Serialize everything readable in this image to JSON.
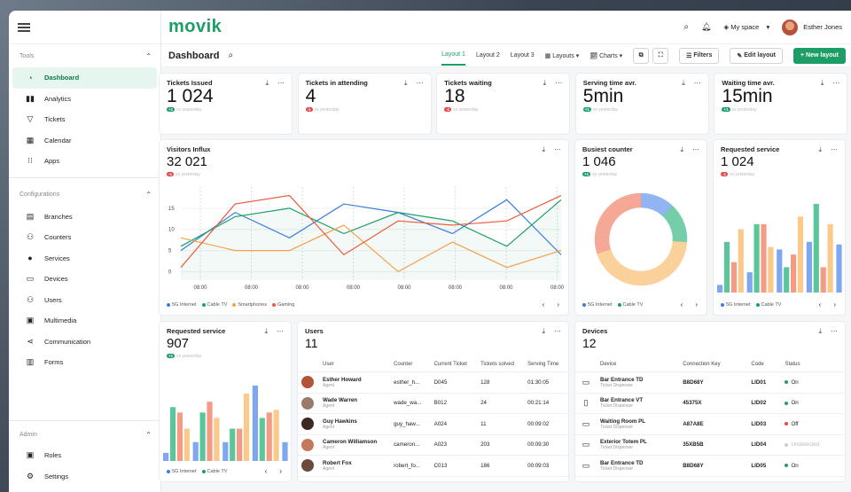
{
  "sidebar": {
    "sec1": "Tools",
    "sec2": "Configurations",
    "sec3": "Admin",
    "tools": [
      {
        "label": "Dashboard",
        "icon": "dashboard-icon"
      },
      {
        "label": "Analytics",
        "icon": "analytics-icon"
      },
      {
        "label": "Tickets",
        "icon": "ticket-icon"
      },
      {
        "label": "Calendar",
        "icon": "calendar-icon"
      },
      {
        "label": "Apps",
        "icon": "apps-icon"
      }
    ],
    "config": [
      {
        "label": "Branches"
      },
      {
        "label": "Counters"
      },
      {
        "label": "Services"
      },
      {
        "label": "Devices"
      },
      {
        "label": "Users"
      },
      {
        "label": "Multimedia"
      },
      {
        "label": "Communication"
      },
      {
        "label": "Forms"
      }
    ],
    "admin": [
      {
        "label": "Roles"
      },
      {
        "label": "Settings"
      }
    ]
  },
  "top": {
    "logo": "movik",
    "space": "My space",
    "user": "Esther Jones"
  },
  "sub": {
    "title": "Dashboard",
    "tabs": [
      "Layout 1",
      "Layout 2",
      "Layout 3"
    ],
    "layouts": "Layouts",
    "charts": "Charts",
    "filters": "Filters",
    "edit": "Edit layout",
    "new": "+ New layout"
  },
  "kpis": [
    {
      "title": "Tickets Issued",
      "value": "1 024",
      "delta": "+1",
      "vs": "vs yesterday",
      "dir": "up"
    },
    {
      "title": "Tickets in attending",
      "value": "4",
      "delta": "-1",
      "vs": "vs yesterday",
      "dir": "down"
    },
    {
      "title": "Tickets waiting",
      "value": "18",
      "delta": "-1",
      "vs": "vs yesterday",
      "dir": "down"
    },
    {
      "title": "Serving time avr.",
      "value": "5min",
      "delta": "+1",
      "vs": "vs yesterday",
      "dir": "up"
    },
    {
      "title": "Waiting time avr.",
      "value": "15min",
      "delta": "+1",
      "vs": "vs yesterday",
      "dir": "up"
    }
  ],
  "visitors": {
    "title": "Visitors Influx",
    "value": "32 021",
    "delta": "-1",
    "vs": "vs yesterday"
  },
  "busiest": {
    "title": "Busiest counter",
    "value": "1 046",
    "delta": "+1",
    "vs": "vs yesterday"
  },
  "req1": {
    "title": "Requested service",
    "value": "1 024",
    "delta": "-1",
    "vs": "vs yesterday"
  },
  "req2": {
    "title": "Requested service",
    "value": "907",
    "delta": "+1",
    "vs": "vs yesterday"
  },
  "users": {
    "title": "Users",
    "count": "11",
    "cols": [
      "User",
      "Counter",
      "Current Ticket",
      "Tickets solved",
      "Serving Time"
    ],
    "rows": [
      {
        "name": "Esther Howard",
        "role": "Agent",
        "counter": "esther_h...",
        "ticket": "D045",
        "solved": "128",
        "time": "01:30:05"
      },
      {
        "name": "Wade Warren",
        "role": "Agent",
        "counter": "wade_wa...",
        "ticket": "B012",
        "solved": "24",
        "time": "00:21:14"
      },
      {
        "name": "Guy Hawkins",
        "role": "Agent",
        "counter": "guy_haw...",
        "ticket": "A024",
        "solved": "11",
        "time": "00:09:02"
      },
      {
        "name": "Cameron Williamson",
        "role": "Agent",
        "counter": "cameron...",
        "ticket": "A023",
        "solved": "203",
        "time": "00:09:30"
      },
      {
        "name": "Robert Fox",
        "role": "Agent",
        "counter": "robert_fo...",
        "ticket": "C013",
        "solved": "186",
        "time": "00:09:03"
      }
    ]
  },
  "devices": {
    "title": "Devices",
    "count": "12",
    "cols": [
      "Device",
      "Connection Key",
      "Code",
      "Status"
    ],
    "rows": [
      {
        "name": "Bar Entrance TD",
        "type": "Ticket Dispenser",
        "key": "B8D68Y",
        "code": "LID01",
        "status": "On",
        "color": "#1e9e67"
      },
      {
        "name": "Bar Entrance VT",
        "type": "Ticket Dispenser",
        "key": "45375X",
        "code": "LID02",
        "status": "On",
        "color": "#1e9e67"
      },
      {
        "name": "Waiting Room PL",
        "type": "Ticket Dispenser",
        "key": "A87A8E",
        "code": "LID03",
        "status": "Off",
        "color": "#e5484d"
      },
      {
        "name": "Exterior Totem PL",
        "type": "Ticket Dispenser",
        "key": "35XB5B",
        "code": "LID04",
        "status": "Undetected",
        "color": "#cccccc"
      },
      {
        "name": "Bar Entrance TD",
        "type": "Ticket Dispenser",
        "key": "B8D68Y",
        "code": "LID05",
        "status": "On",
        "color": "#1e9e67"
      }
    ]
  },
  "chart_data": [
    {
      "type": "line",
      "title": "Visitors Influx",
      "categories": [
        "08:00",
        "08:00",
        "08:00",
        "08:00",
        "08:00",
        "08:00",
        "08:00",
        "08:00"
      ],
      "yticks": [
        "15",
        "10",
        "5",
        "0"
      ],
      "ylim": [
        -2,
        20
      ],
      "series": [
        {
          "name": "5G Internet",
          "color": "#3b7ddd",
          "values": [
            5,
            14,
            8,
            16,
            14,
            9,
            17,
            4
          ]
        },
        {
          "name": "Cable TV",
          "color": "#1e9e67",
          "values": [
            6,
            13,
            15,
            9,
            14,
            12,
            6,
            17
          ]
        },
        {
          "name": "Smartphones",
          "color": "#f5a04a",
          "values": [
            8,
            5,
            5,
            11,
            0,
            7,
            1,
            5
          ]
        },
        {
          "name": "Gaming",
          "color": "#ef5a3c",
          "values": [
            1,
            16,
            18,
            4,
            12,
            11,
            12,
            18
          ]
        }
      ]
    },
    {
      "type": "pie",
      "title": "Busiest counter",
      "legend": [
        "5G Internet",
        "Cable TV"
      ],
      "slices": [
        {
          "value": 12,
          "color": "#7fa7f0"
        },
        {
          "value": 14,
          "color": "#5cc69b"
        },
        {
          "value": 44,
          "color": "#fbc98a"
        },
        {
          "value": 30,
          "color": "#f59a84"
        }
      ]
    },
    {
      "type": "bar",
      "title": "Requested service (1 024)",
      "legend": [
        "5G Internet",
        "Cable TV"
      ],
      "values": [
        3,
        20,
        12,
        25,
        8,
        27,
        27,
        18,
        17,
        10,
        15,
        30,
        20,
        35,
        10,
        27,
        19
      ]
    },
    {
      "type": "bar",
      "title": "Requested service (907)",
      "legend": [
        "5G Internet",
        "Cable TV"
      ],
      "values": [
        3,
        20,
        18,
        12,
        7,
        18,
        22,
        16,
        7,
        12,
        12,
        25,
        28,
        16,
        18,
        19,
        7
      ]
    }
  ]
}
